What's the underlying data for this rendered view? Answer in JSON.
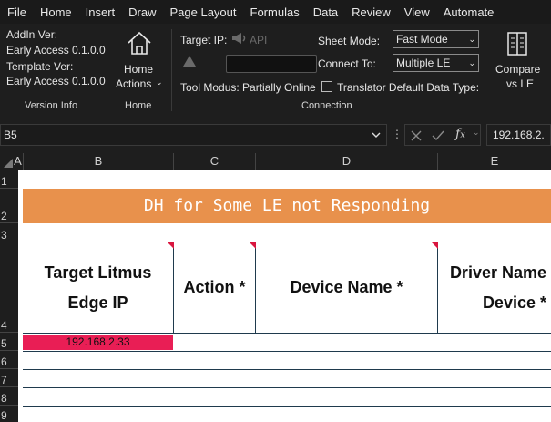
{
  "menu": [
    "File",
    "Home",
    "Insert",
    "Draw",
    "Page Layout",
    "Formulas",
    "Data",
    "Review",
    "View",
    "Automate"
  ],
  "ribbon": {
    "version_info": {
      "addin_label": "AddIn Ver:",
      "addin_value": "Early Access 0.1.0.0",
      "template_label": "Template Ver:",
      "template_value": "Early Access 0.1.0.0",
      "group_label": "Version Info"
    },
    "home": {
      "button_line1": "Home",
      "button_line2": "Actions",
      "group_label": "Home"
    },
    "connection": {
      "target_ip_label": "Target IP:",
      "api_label": "API",
      "sheet_mode_label": "Sheet Mode:",
      "sheet_mode_value": "Fast Mode",
      "connect_to_label": "Connect To:",
      "connect_to_value": "Multiple LE",
      "tool_modus": "Tool Modus: Partially Online",
      "translator_label": "Translator Default Data Type:",
      "group_label": "Connection"
    },
    "compare": {
      "line1": "Compare",
      "line2": "vs LE"
    }
  },
  "formula_bar": {
    "name_box": "B5",
    "value": "192.168.2."
  },
  "columns": [
    "A",
    "B",
    "C",
    "D",
    "E"
  ],
  "rows": [
    "1",
    "2",
    "3",
    "4",
    "5",
    "6",
    "7",
    "8",
    "9"
  ],
  "sheet": {
    "banner": "DH for Some LE not Responding",
    "headers": {
      "target_ip_line1": "Target Litmus",
      "target_ip_line2": "Edge IP",
      "action": "Action *",
      "device_name": "Device Name *",
      "driver_line1": "Driver Name",
      "driver_line2": "Device *"
    },
    "cell_b5": "192.168.2.33"
  },
  "colors": {
    "banner": "#e8914c",
    "ip_cell": "#e91e55",
    "comment_marker": "#d9163f"
  }
}
